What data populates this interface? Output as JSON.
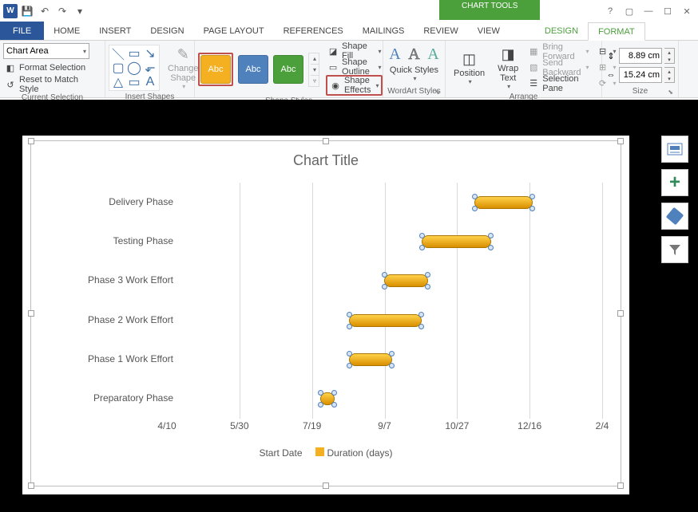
{
  "qat": {
    "save": "💾",
    "undo": "↶",
    "redo": "↷",
    "customize": "▾"
  },
  "tabs": {
    "file": "FILE",
    "home": "HOME",
    "insert": "INSERT",
    "design": "DESIGN",
    "layout": "PAGE LAYOUT",
    "refs": "REFERENCES",
    "mail": "MAILINGS",
    "review": "REVIEW",
    "view": "VIEW",
    "ctx_title": "CHART TOOLS",
    "ctx_design": "DESIGN",
    "ctx_format": "FORMAT"
  },
  "winctrl": {
    "help": "?",
    "opts": "▢",
    "min": "—",
    "max": "☐",
    "close": "✕"
  },
  "ribbon": {
    "selection": {
      "combo": "Chart Area",
      "format_sel": "Format Selection",
      "reset": "Reset to Match Style",
      "label": "Current Selection"
    },
    "shapes": {
      "change": "Change Shape",
      "label": "Insert Shapes"
    },
    "styles": {
      "swatch": "Abc",
      "fill": "Shape Fill",
      "outline": "Shape Outline",
      "effects": "Shape Effects",
      "label": "Shape Styles"
    },
    "wordart": {
      "quick": "Quick Styles",
      "label": "WordArt Styles"
    },
    "arrange": {
      "position": "Position",
      "wrap": "Wrap Text",
      "fwd": "Bring Forward",
      "back": "Send Backward",
      "selpane": "Selection Pane",
      "label": "Arrange"
    },
    "size": {
      "h": "8.89 cm",
      "w": "15.24 cm",
      "label": "Size"
    }
  },
  "chart_data": {
    "type": "bar",
    "title": "Chart Title",
    "xlabel": "",
    "ylabel": "",
    "x_ticks": [
      "4/10",
      "5/30",
      "7/19",
      "9/7",
      "10/27",
      "12/16",
      "2/4"
    ],
    "categories": [
      "Preparatory Phase",
      "Phase 1 Work Effort",
      "Phase 2 Work Effort",
      "Phase 3 Work Effort",
      "Testing Phase",
      "Delivery Phase"
    ],
    "series": [
      {
        "name": "Start Date",
        "values": [
          "7/24",
          "8/13",
          "8/13",
          "9/7",
          "10/2",
          "11/8"
        ]
      },
      {
        "name": "Duration (days)",
        "values": [
          10,
          30,
          50,
          30,
          48,
          40
        ]
      }
    ],
    "legend": [
      "Start Date",
      "Duration (days)"
    ]
  },
  "side": {
    "elements": "Chart Elements",
    "styles": "Chart Styles",
    "filters": "Chart Filters"
  }
}
